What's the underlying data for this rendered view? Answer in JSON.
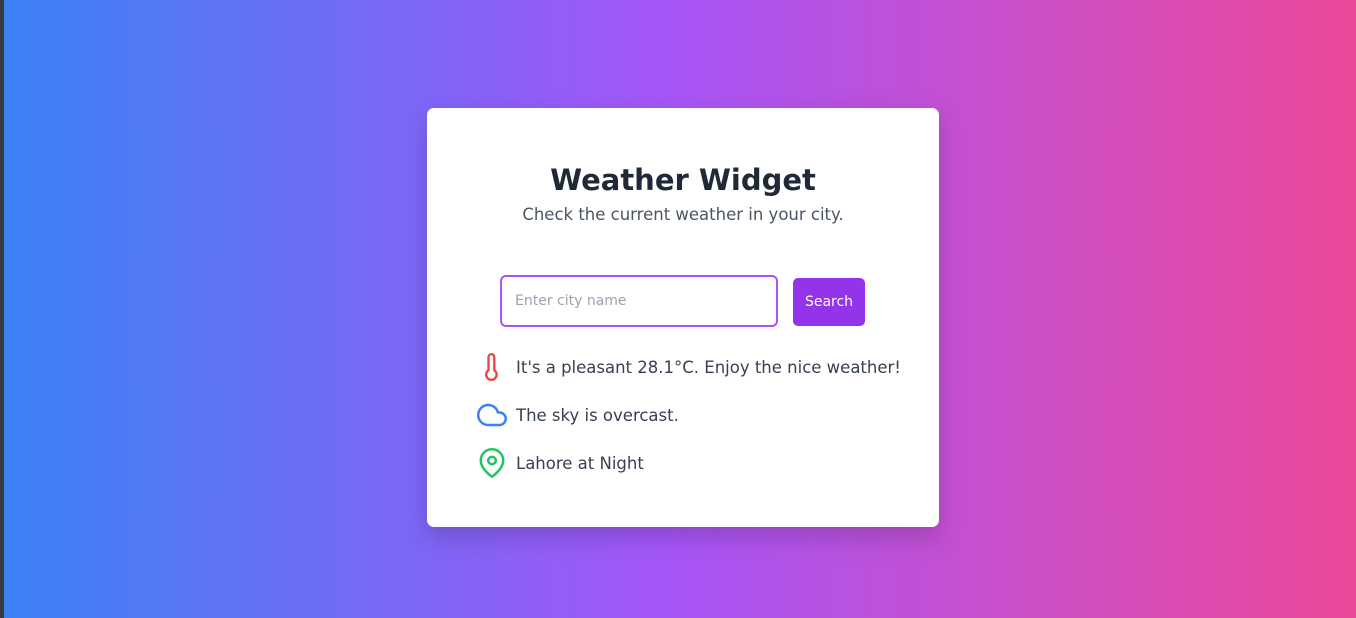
{
  "widget": {
    "title": "Weather Widget",
    "subtitle": "Check the current weather in your city.",
    "search": {
      "placeholder": "Enter city name",
      "value": "",
      "button_label": "Search"
    },
    "results": {
      "temperature_text": "It's a pleasant 28.1°C. Enjoy the nice weather!",
      "sky_text": "The sky is overcast.",
      "location_text": "Lahore at Night"
    },
    "icons": {
      "temperature": "thermometer-icon",
      "sky": "cloud-icon",
      "location": "map-pin-icon"
    },
    "colors": {
      "background_start": "#3b82f6",
      "background_mid": "#a855f7",
      "background_end": "#ec4899",
      "accent": "#9333ea",
      "thermometer": "#ef4444",
      "cloud": "#3b82f6",
      "pin": "#22c55e"
    }
  }
}
